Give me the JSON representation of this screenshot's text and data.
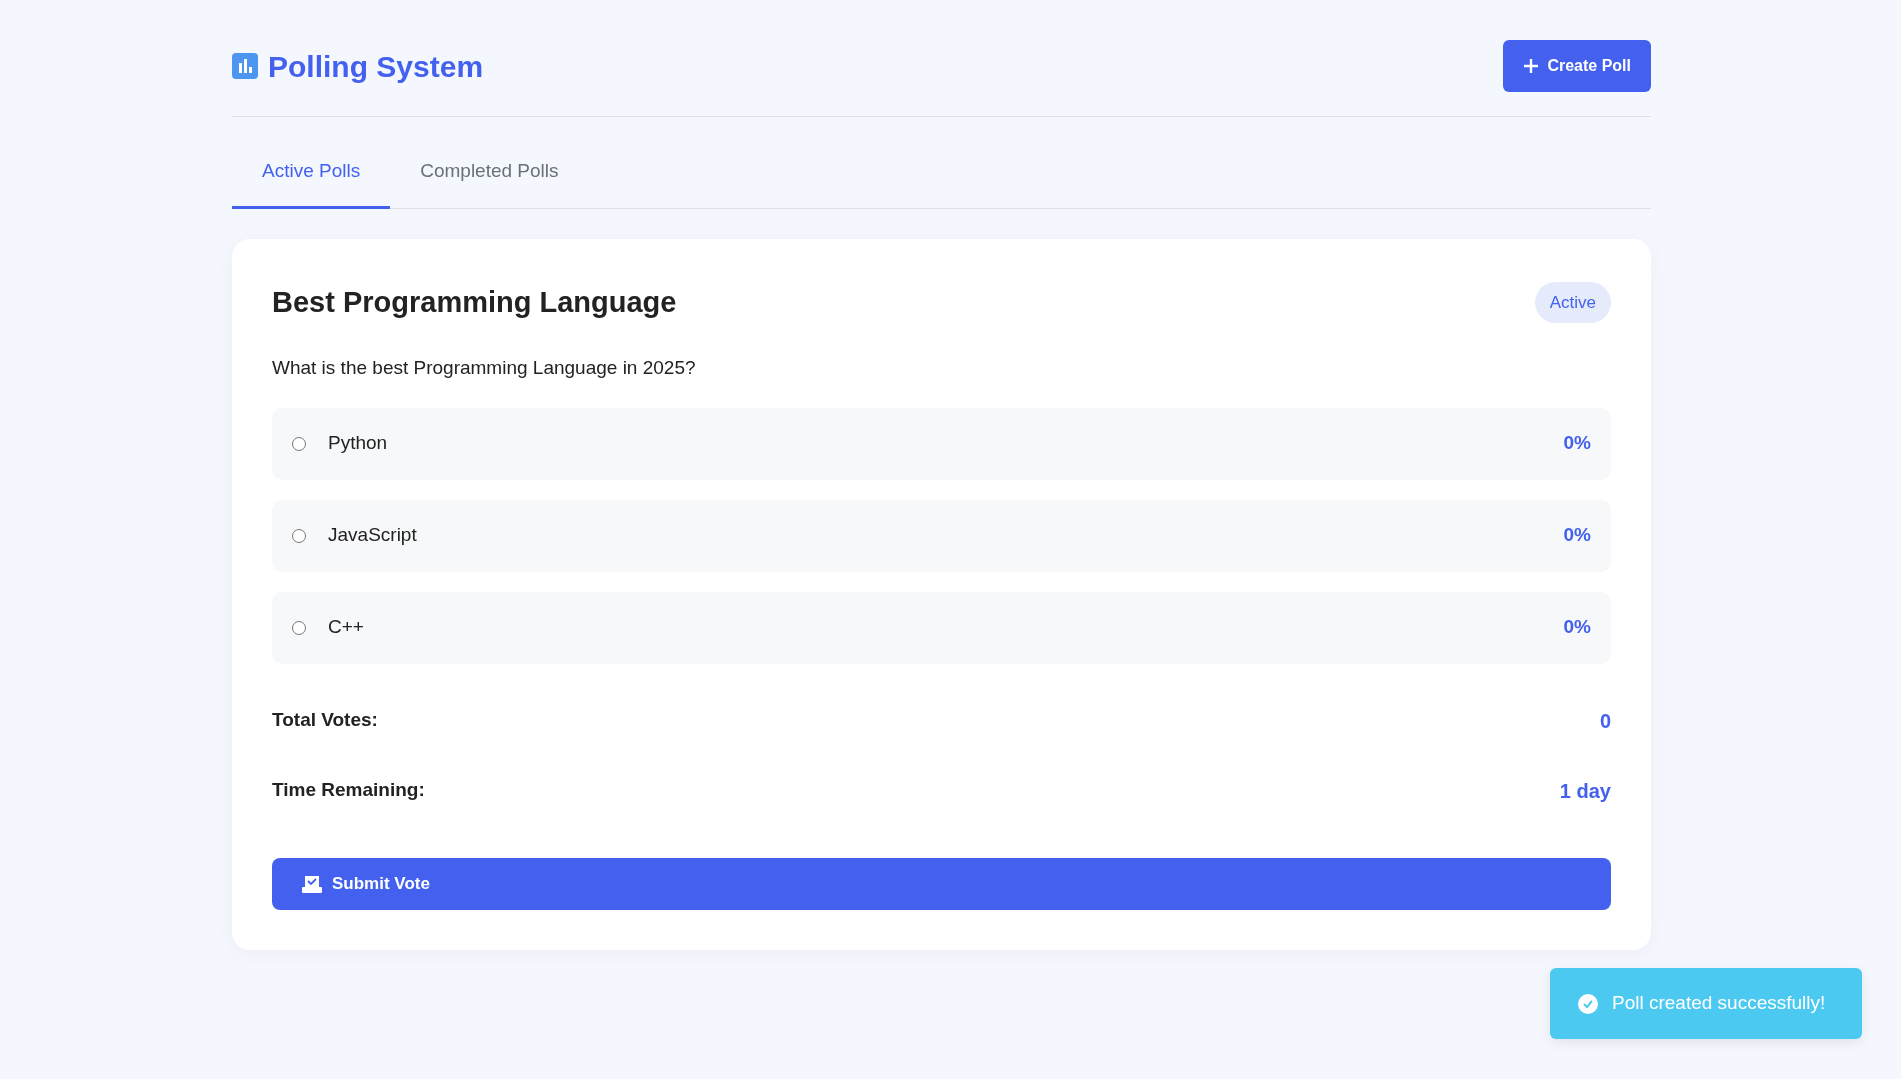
{
  "header": {
    "title": "Polling System",
    "create_button": "Create Poll"
  },
  "tabs": [
    {
      "label": "Active Polls",
      "selected": true
    },
    {
      "label": "Completed Polls",
      "selected": false
    }
  ],
  "poll": {
    "title": "Best Programming Language",
    "status": "Active",
    "question": "What is the best Programming Language in 2025?",
    "options": [
      {
        "label": "Python",
        "percent": "0%",
        "selected": false
      },
      {
        "label": "JavaScript",
        "percent": "0%",
        "selected": false
      },
      {
        "label": "C++",
        "percent": "0%",
        "selected": false
      }
    ],
    "stats": [
      {
        "label": "Total Votes:",
        "value": "0"
      },
      {
        "label": "Time Remaining:",
        "value": "1 day"
      }
    ],
    "submit_button": "Submit Vote"
  },
  "toast": {
    "message": "Poll created successfully!"
  }
}
